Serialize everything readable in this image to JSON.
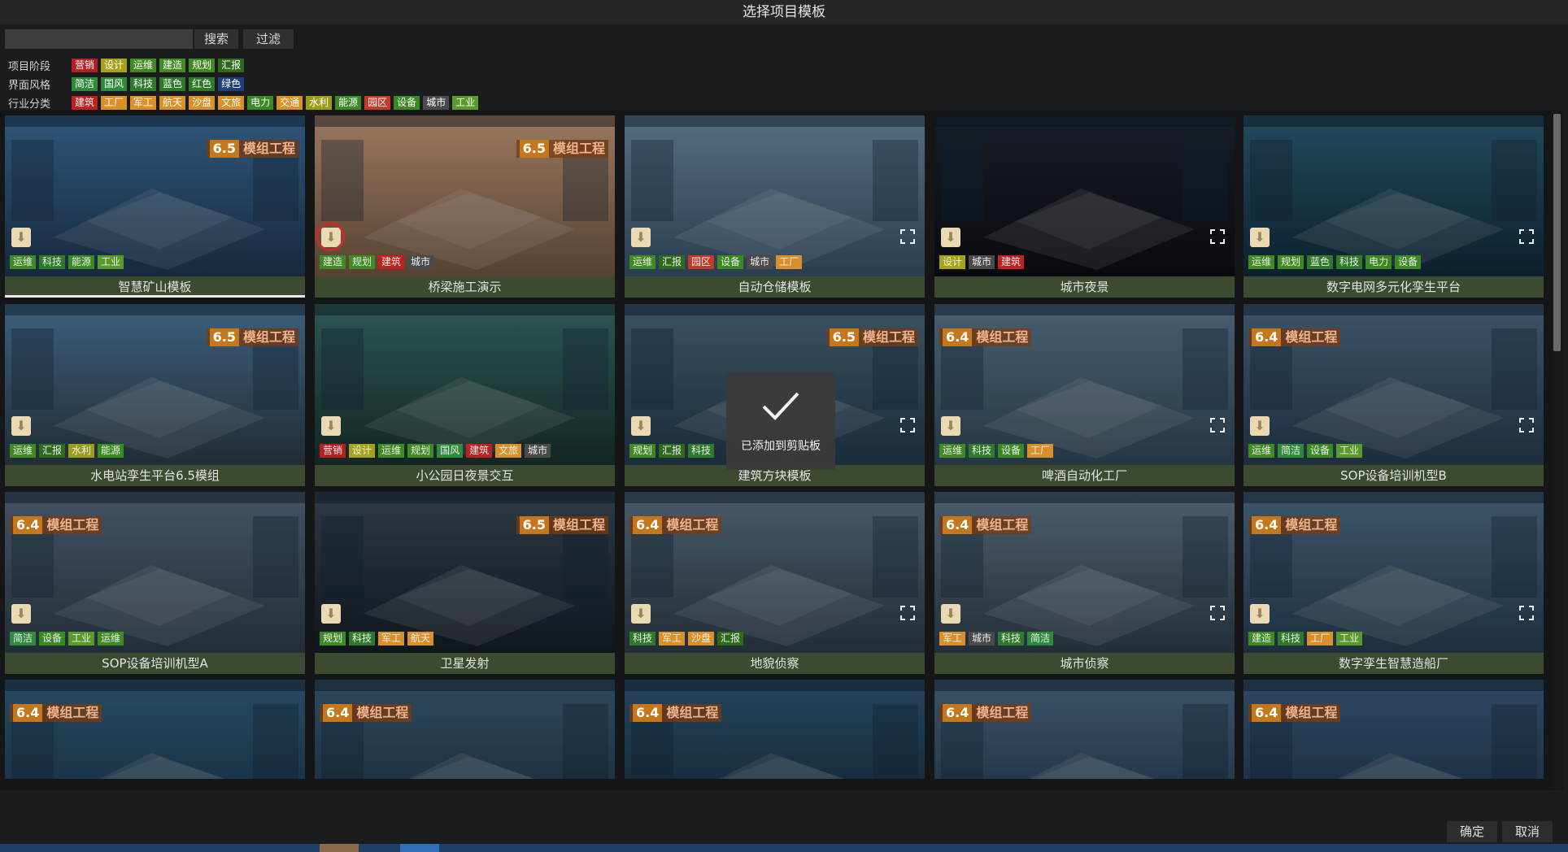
{
  "dialog": {
    "title": "选择项目模板"
  },
  "toolbar": {
    "search_placeholder": "",
    "search_label": "搜索",
    "filter_label": "过滤"
  },
  "filters": [
    {
      "label": "项目阶段",
      "tags": [
        {
          "text": "营销",
          "color": "#b81e1e"
        },
        {
          "text": "设计",
          "color": "#a7a318"
        },
        {
          "text": "运维",
          "color": "#3f8a22"
        },
        {
          "text": "建造",
          "color": "#3f8a22"
        },
        {
          "text": "规划",
          "color": "#3f8a22"
        },
        {
          "text": "汇报",
          "color": "#2d6a1c"
        }
      ]
    },
    {
      "label": "界面风格",
      "tags": [
        {
          "text": "简洁",
          "color": "#2f8a3a"
        },
        {
          "text": "国风",
          "color": "#2f8a3a"
        },
        {
          "text": "科技",
          "color": "#2f7a2a"
        },
        {
          "text": "蓝色",
          "color": "#2f7a2a"
        },
        {
          "text": "红色",
          "color": "#2f7a2a"
        },
        {
          "text": "绿色",
          "color": "#1f3f7a"
        }
      ]
    },
    {
      "label": "行业分类",
      "tags": [
        {
          "text": "建筑",
          "color": "#c21f1f"
        },
        {
          "text": "工厂",
          "color": "#d9902a"
        },
        {
          "text": "军工",
          "color": "#d9902a"
        },
        {
          "text": "航天",
          "color": "#d9902a"
        },
        {
          "text": "沙盘",
          "color": "#d9902a"
        },
        {
          "text": "文旅",
          "color": "#d9902a"
        },
        {
          "text": "电力",
          "color": "#3a8a22"
        },
        {
          "text": "交通",
          "color": "#d9902a"
        },
        {
          "text": "水利",
          "color": "#9b9b1a"
        },
        {
          "text": "能源",
          "color": "#3a8a22"
        },
        {
          "text": "园区",
          "color": "#c43a2a"
        },
        {
          "text": "设备",
          "color": "#3a8a22"
        },
        {
          "text": "城市",
          "color": "#4a4a4a"
        },
        {
          "text": "工业",
          "color": "#5a9a2a"
        }
      ]
    }
  ],
  "templates": [
    {
      "name": "智慧矿山模板",
      "version": "6.5",
      "version_text": "模组工程",
      "tags": [
        "运维",
        "科技",
        "能源",
        "工业"
      ],
      "bg": [
        "#3d6f9c",
        "#1d3550"
      ],
      "fullscreen": false,
      "selected": true
    },
    {
      "name": "桥梁施工演示",
      "version": "6.5",
      "version_text": "模组工程",
      "tags": [
        "建造",
        "规划",
        "建筑",
        "城市"
      ],
      "bg": [
        "#c79a7a",
        "#6f5540"
      ],
      "fullscreen": false,
      "highlight": true
    },
    {
      "name": "自动仓储模板",
      "version": "",
      "version_text": "",
      "tags": [
        "运维",
        "汇报",
        "园区",
        "设备",
        "城市",
        "工厂"
      ],
      "bg": [
        "#6e8da8",
        "#355066"
      ],
      "fullscreen": true
    },
    {
      "name": "城市夜景",
      "version": "",
      "version_text": "",
      "tags": [
        "设计",
        "城市",
        "建筑"
      ],
      "bg": [
        "#1f2632",
        "#0b0e13"
      ],
      "fullscreen": true
    },
    {
      "name": "数字电网多元化孪生平台",
      "version": "",
      "version_text": "",
      "tags": [
        "运维",
        "规划",
        "蓝色",
        "科技",
        "电力",
        "设备"
      ],
      "bg": [
        "#2e5f78",
        "#0f2a3a"
      ],
      "fullscreen": true
    },
    {
      "name": "水电站孪生平台6.5模组",
      "version": "6.5",
      "version_text": "模组工程",
      "tags": [
        "运维",
        "汇报",
        "水利",
        "能源"
      ],
      "bg": [
        "#4e7aa0",
        "#2a3a44"
      ],
      "fullscreen": false
    },
    {
      "name": "小公园日夜景交互",
      "version": "",
      "version_text": "",
      "tags": [
        "营销",
        "设计",
        "运维",
        "规划",
        "国风",
        "建筑",
        "文旅",
        "城市"
      ],
      "bg": [
        "#3a6f6a",
        "#18302e"
      ],
      "fullscreen": false
    },
    {
      "name": "建筑方块模板",
      "version": "6.5",
      "version_text": "模组工程",
      "tags": [
        "规划",
        "汇报",
        "科技"
      ],
      "bg": [
        "#4a6a7e",
        "#22384a"
      ],
      "fullscreen": true
    },
    {
      "name": "啤酒自动化工厂",
      "version": "6.4",
      "version_text": "模组工程",
      "tags": [
        "运维",
        "科技",
        "设备",
        "工厂"
      ],
      "bg": [
        "#5d7a90",
        "#304656"
      ],
      "fullscreen": true
    },
    {
      "name": "SOP设备培训机型B",
      "version": "6.4",
      "version_text": "模组工程",
      "tags": [
        "运维",
        "简洁",
        "设备",
        "工业"
      ],
      "bg": [
        "#4e6b88",
        "#263a4c"
      ],
      "fullscreen": true
    },
    {
      "name": "SOP设备培训机型A",
      "version": "6.4",
      "version_text": "模组工程",
      "tags": [
        "简洁",
        "设备",
        "工业",
        "运维"
      ],
      "bg": [
        "#566b80",
        "#2c3b48"
      ],
      "fullscreen": false
    },
    {
      "name": "卫星发射",
      "version": "6.5",
      "version_text": "模组工程",
      "tags": [
        "规划",
        "科技",
        "军工",
        "航天"
      ],
      "bg": [
        "#3b4a58",
        "#141c24"
      ],
      "fullscreen": false
    },
    {
      "name": "地貌侦察",
      "version": "6.4",
      "version_text": "模组工程",
      "tags": [
        "科技",
        "军工",
        "沙盘",
        "汇报"
      ],
      "bg": [
        "#5e7488",
        "#2c3a46"
      ],
      "fullscreen": true
    },
    {
      "name": "城市侦察",
      "version": "6.4",
      "version_text": "模组工程",
      "tags": [
        "军工",
        "城市",
        "科技",
        "简洁"
      ],
      "bg": [
        "#637a8c",
        "#2e3c48"
      ],
      "fullscreen": true
    },
    {
      "name": "数字孪生智慧造船厂",
      "version": "6.4",
      "version_text": "模组工程",
      "tags": [
        "建造",
        "科技",
        "工厂",
        "工业"
      ],
      "bg": [
        "#4f6f8a",
        "#263c50"
      ],
      "fullscreen": true
    },
    {
      "name": "",
      "version": "6.4",
      "version_text": "模组工程",
      "tags": [],
      "bg": [
        "#34607f",
        "#193247"
      ],
      "fullscreen": false
    },
    {
      "name": "",
      "version": "6.4",
      "version_text": "模组工程",
      "tags": [],
      "bg": [
        "#3c5f78",
        "#1b3044"
      ],
      "fullscreen": false
    },
    {
      "name": "",
      "version": "6.4",
      "version_text": "模组工程",
      "tags": [],
      "bg": [
        "#2f5876",
        "#142a3c"
      ],
      "fullscreen": false
    },
    {
      "name": "",
      "version": "6.4",
      "version_text": "模组工程",
      "tags": [],
      "bg": [
        "#4a6a88",
        "#20364a"
      ],
      "fullscreen": false
    },
    {
      "name": "",
      "version": "6.4",
      "version_text": "模组工程",
      "tags": [],
      "bg": [
        "#3a5f80",
        "#1b3046"
      ],
      "fullscreen": false
    }
  ],
  "tag_colors": {
    "营销": "#b81e1e",
    "设计": "#a7a318",
    "运维": "#3f8a22",
    "建造": "#3f8a22",
    "规划": "#3f8a22",
    "汇报": "#2d6a1c",
    "简洁": "#2f8a3a",
    "国风": "#2f8a3a",
    "科技": "#2f7a2a",
    "蓝色": "#2f7a2a",
    "红色": "#2f7a2a",
    "绿色": "#1f3f7a",
    "建筑": "#c21f1f",
    "工厂": "#d9902a",
    "军工": "#d9902a",
    "航天": "#d9902a",
    "沙盘": "#d9902a",
    "文旅": "#d9902a",
    "电力": "#3a8a22",
    "交通": "#d9902a",
    "水利": "#9b9b1a",
    "能源": "#3a8a22",
    "园区": "#c43a2a",
    "设备": "#3a8a22",
    "城市": "#4a4a4a",
    "工业": "#5a9a2a"
  },
  "toast": {
    "text": "已添加到剪贴板",
    "icon": "check-icon"
  },
  "footer": {
    "ok_label": "确定",
    "cancel_label": "取消"
  }
}
